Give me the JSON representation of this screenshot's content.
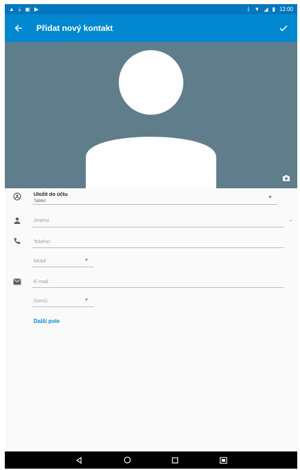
{
  "status_bar": {
    "left_icons": [
      "warning-icon",
      "download-icon",
      "gallery-icon",
      "play-icon"
    ],
    "right_icons": [
      "bluetooth-icon",
      "wifi-icon",
      "signal-icon",
      "battery-icon"
    ],
    "time": "12:00"
  },
  "toolbar": {
    "title": "Přidat nový kontakt",
    "back_icon": "arrow-back-icon",
    "save_icon": "check-icon"
  },
  "photo": {
    "background": "#607d8b",
    "placeholder_icon": "person-silhouette-icon",
    "camera_icon": "camera-icon"
  },
  "form": {
    "account": {
      "label": "Uložit do účtu",
      "value": "Tablet"
    },
    "name": {
      "placeholder": "Jméno"
    },
    "phone": {
      "placeholder": "Telefon",
      "type_value": "Mobil"
    },
    "email": {
      "placeholder": "E-mail",
      "type_value": "Domů"
    },
    "more_fields_label": "Další pole"
  },
  "colors": {
    "status_bar": "#0277bd",
    "toolbar": "#0288d1",
    "accent": "#0288d1"
  }
}
